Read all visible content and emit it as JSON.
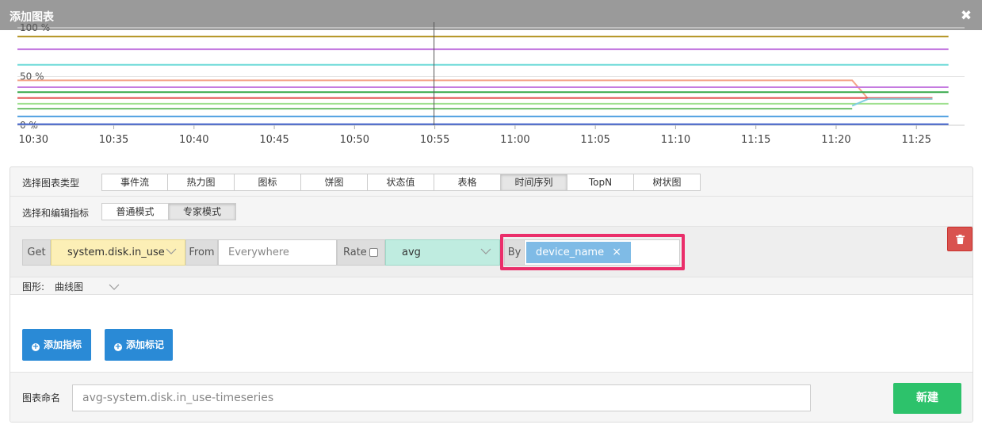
{
  "dialog": {
    "title": "添加图表"
  },
  "chart_data": {
    "type": "line",
    "y_ticks": [
      "100 %",
      "50 %",
      "0 %"
    ],
    "x_ticks": [
      "10:30",
      "10:35",
      "10:40",
      "10:45",
      "10:50",
      "10:55",
      "11:00",
      "11:05",
      "11:10",
      "11:15",
      "11:20",
      "11:25"
    ],
    "ylim": [
      0,
      100
    ],
    "grid": true,
    "cursor_time": "10:55",
    "series": [
      {
        "color": "#b39321",
        "values": [
          {
            "t": "10:29",
            "v": 91
          },
          {
            "t": "11:27",
            "v": 91
          }
        ]
      },
      {
        "color": "#c57be0",
        "values": [
          {
            "t": "10:29",
            "v": 78
          },
          {
            "t": "11:27",
            "v": 78
          }
        ]
      },
      {
        "color": "#6fdad8",
        "values": [
          {
            "t": "10:29",
            "v": 62
          },
          {
            "t": "11:27",
            "v": 62
          }
        ]
      },
      {
        "color": "#f4a488",
        "values": [
          {
            "t": "10:29",
            "v": 46
          },
          {
            "t": "11:21",
            "v": 46
          },
          {
            "t": "11:22",
            "v": 27
          },
          {
            "t": "11:26",
            "v": 27
          }
        ]
      },
      {
        "color": "#c57be0",
        "values": [
          {
            "t": "10:29",
            "v": 39
          },
          {
            "t": "11:27",
            "v": 39
          }
        ]
      },
      {
        "color": "#36a84a",
        "values": [
          {
            "t": "10:29",
            "v": 34
          },
          {
            "t": "11:27",
            "v": 34
          }
        ]
      },
      {
        "color": "#e04848",
        "values": [
          {
            "t": "10:29",
            "v": 28
          },
          {
            "t": "11:26",
            "v": 28
          }
        ]
      },
      {
        "color": "#9fe08f",
        "values": [
          {
            "t": "10:29",
            "v": 22
          },
          {
            "t": "11:27",
            "v": 22
          }
        ]
      },
      {
        "color": "#6ec06a",
        "values": [
          {
            "t": "10:29",
            "v": 17
          },
          {
            "t": "11:21",
            "v": 17
          }
        ]
      },
      {
        "color": "#7fcfe0",
        "values": [
          {
            "t": "11:21",
            "v": 20
          },
          {
            "t": "11:22",
            "v": 27
          },
          {
            "t": "11:26",
            "v": 27
          }
        ]
      },
      {
        "color": "#4f9fe0",
        "values": [
          {
            "t": "10:29",
            "v": 9
          },
          {
            "t": "11:27",
            "v": 9
          }
        ]
      },
      {
        "color": "#2a4fc8",
        "values": [
          {
            "t": "10:29",
            "v": 1
          },
          {
            "t": "11:27",
            "v": 1
          }
        ]
      }
    ]
  },
  "chart_type": {
    "label": "选择图表类型",
    "tabs": [
      "事件流",
      "热力图",
      "图标",
      "饼图",
      "状态值",
      "表格",
      "时间序列",
      "TopN",
      "树状图"
    ],
    "active": "时间序列"
  },
  "metric_mode": {
    "label": "选择和编辑指标",
    "tabs": [
      "普通模式",
      "专家模式"
    ],
    "active": "专家模式"
  },
  "query": {
    "get_label": "Get",
    "metric": "system.disk.in_use",
    "from_label": "From",
    "from_placeholder": "Everywhere",
    "rate_label": "Rate",
    "rate_checked": false,
    "aggregation": "avg",
    "by_label": "By",
    "by_tags": [
      "device_name"
    ],
    "remove_tag": "×",
    "delete_icon": "trash-icon"
  },
  "shape": {
    "label": "图形:",
    "value": "曲线图"
  },
  "actions": {
    "add_metric": "添加指标",
    "add_marker": "添加标记"
  },
  "chart_name": {
    "label": "图表命名",
    "value": "avg-system.disk.in_use-timeseries"
  },
  "create_button": "新建",
  "colors": {
    "accent_blue": "#2a8ad6",
    "create_green": "#2dc26b",
    "highlight": "#ea2e6a",
    "delete_red": "#d9534f"
  }
}
